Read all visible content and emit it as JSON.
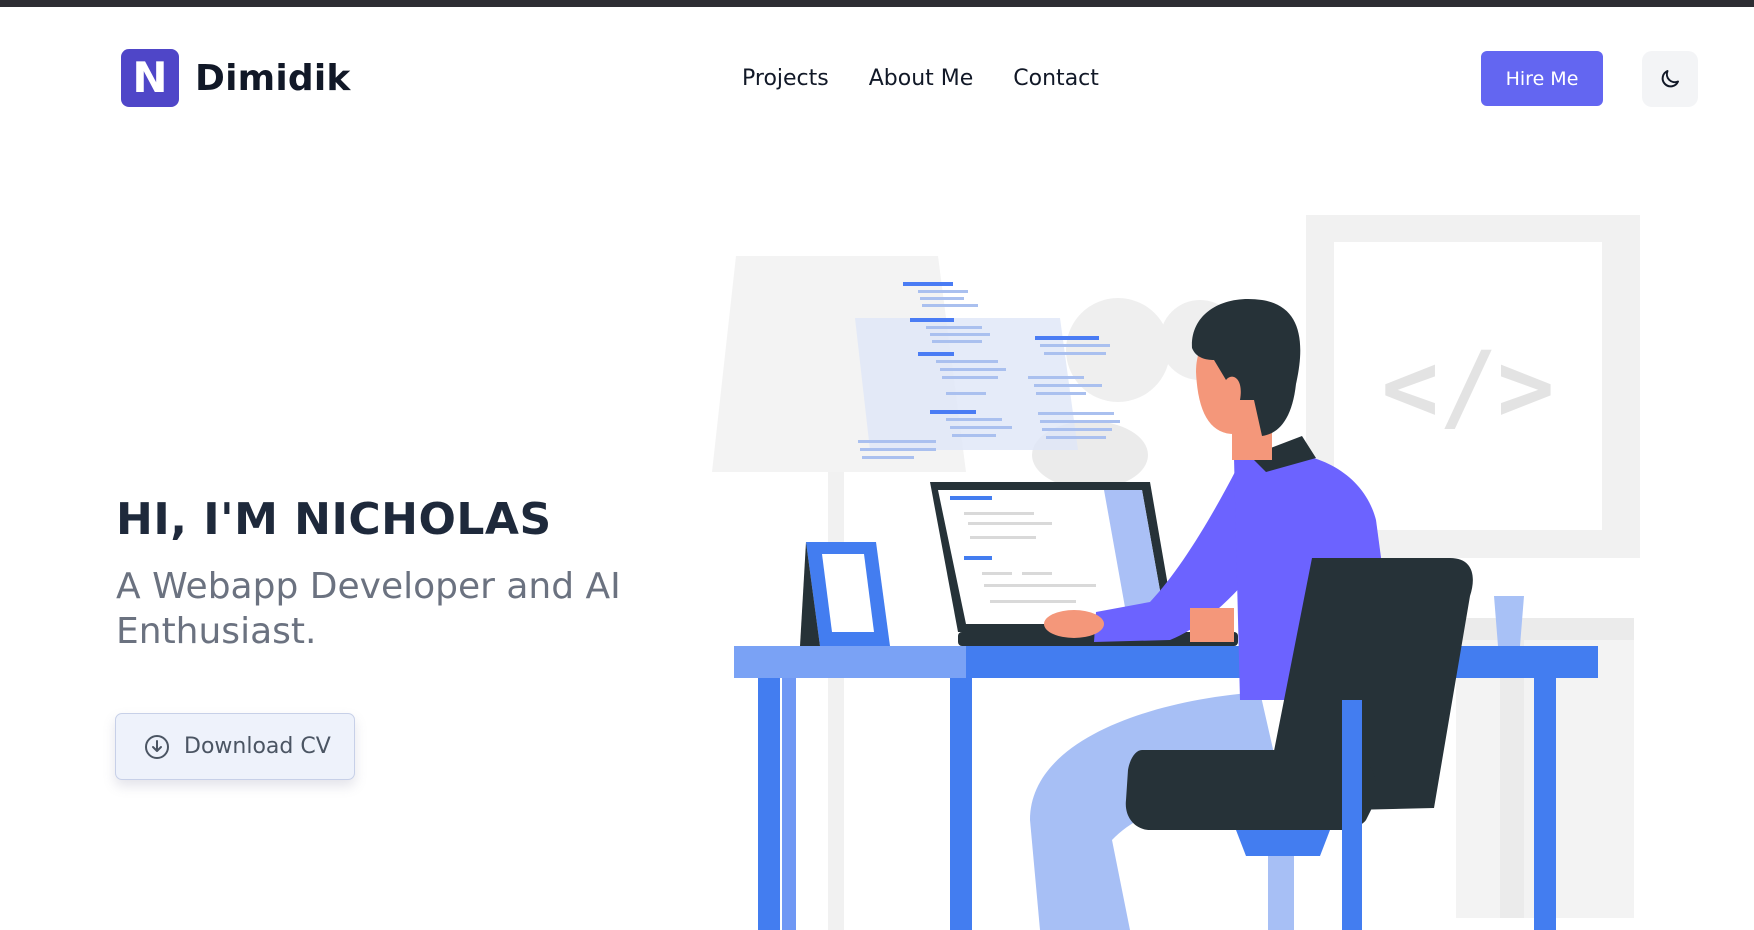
{
  "brand": {
    "logo_letter": "N",
    "name": "Dimidik",
    "logo_color": "#4f46c8"
  },
  "nav": {
    "items": [
      "Projects",
      "About Me",
      "Contact"
    ]
  },
  "header": {
    "hire_label": "Hire Me",
    "theme_icon": "moon-icon",
    "accent": "#6366f1"
  },
  "hero": {
    "title": "HI, I'M NICHOLAS",
    "subtitle": "A Webapp Developer and AI Enthusiast.",
    "cv_label": "Download CV",
    "cv_icon": "download-circle-icon"
  },
  "illustration": {
    "sign_text": "</>"
  }
}
